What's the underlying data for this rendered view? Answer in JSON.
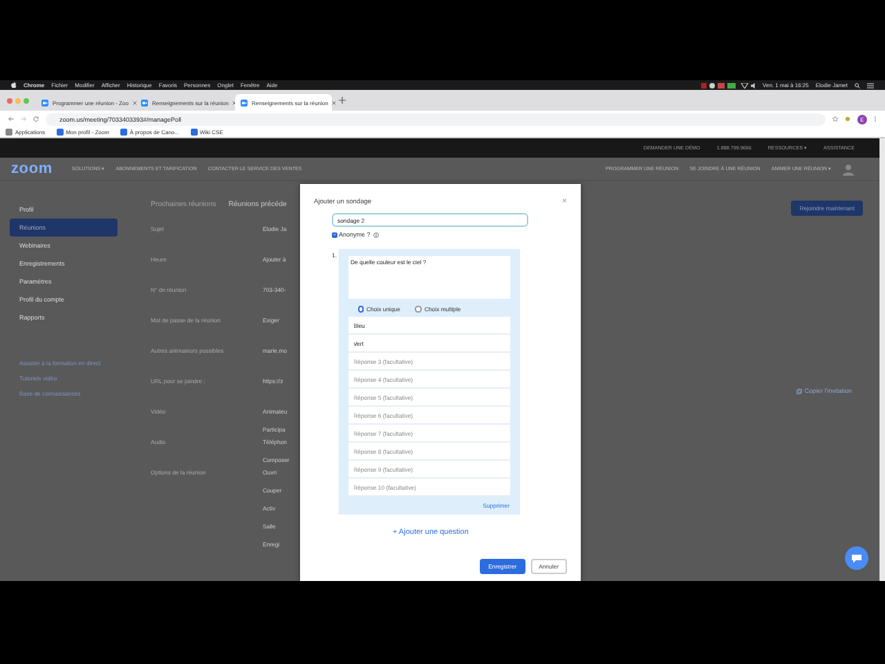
{
  "menu_bar": {
    "app": "Chrome",
    "items": [
      "Fichier",
      "Modifier",
      "Afficher",
      "Historique",
      "Favoris",
      "Personnes",
      "Onglet",
      "Fenêtre",
      "Aide"
    ],
    "clock": "Ven. 1 mai à 16:25",
    "user": "Elodie Jamet"
  },
  "browser_tabs": [
    {
      "title": "Programmer une réunion - Zoo",
      "selected": false
    },
    {
      "title": "Renseignements sur la réunion",
      "selected": false
    },
    {
      "title": "Renseignements sur la réunion",
      "selected": true
    }
  ],
  "address_bar": {
    "url": "zoom.us/meeting/7033403393#/managePoll",
    "profile_initial": "E"
  },
  "bookmarks": [
    "Applications",
    "Mon profil - Zoom",
    "À propos de Cano...",
    "Wiki CSE"
  ],
  "top_nav": [
    "DEMANDER UNE DÉMO",
    "1.888.799.9666",
    "RESSOURCES ▾",
    "ASSISTANCE"
  ],
  "main_nav": {
    "logo": "zoom",
    "left": [
      "SOLUTIONS ▾",
      "ABONNEMENTS ET TARIFICATION",
      "CONTACTER LE SERVICE DES VENTES"
    ],
    "right": [
      "PROGRAMMER UNE RÉUNION",
      "SE JOINDRE À UNE RÉUNION",
      "ANIMER UNE RÉUNION ▾"
    ]
  },
  "sidebar": {
    "items": [
      {
        "label": "Profil",
        "selected": false
      },
      {
        "label": "Réunions",
        "selected": true
      },
      {
        "label": "Webinaires",
        "selected": false
      },
      {
        "label": "Enregistrements",
        "selected": false
      },
      {
        "label": "Paramètres",
        "selected": false
      },
      {
        "label": "Profil du compte",
        "selected": false
      },
      {
        "label": "Rapports",
        "selected": false
      }
    ],
    "links": [
      "Assister à la formation en direct",
      "Tutoriels vidéo",
      "Base de connaissances"
    ]
  },
  "meeting_tabs": [
    {
      "label": "Prochaines réunions",
      "selected": false
    },
    {
      "label": "Réunions précéde",
      "selected": true
    }
  ],
  "details": [
    {
      "label": "Sujet",
      "values": [
        "Elodie Ja"
      ]
    },
    {
      "label": "Heure",
      "values": [
        "Ajouter à"
      ]
    },
    {
      "label": "N° de réunion",
      "values": [
        "703-340-"
      ]
    },
    {
      "label": "Mot de passe de la réunion",
      "values": [
        "Exiger"
      ]
    },
    {
      "label": "Autres animateurs possibles",
      "values": [
        "marie.mo"
      ]
    },
    {
      "label": "URL pour se joindre :",
      "values": [
        "https://z"
      ]
    },
    {
      "label": "Vidéo",
      "values": [
        "Animateu",
        "Participa"
      ]
    },
    {
      "label": "Audio",
      "values": [
        "Téléphon",
        "Composer"
      ]
    },
    {
      "label": "Options de la réunion",
      "values": [
        "Ouvri",
        "Couper",
        "Activ",
        "Salle",
        "Enregi"
      ]
    }
  ],
  "join_button": "Rejoindre maintenant",
  "copy_invitation": "Copier l'invitation",
  "dialog": {
    "title": "Ajouter un sondage",
    "close": "×",
    "poll_name": "sondage 2",
    "anonymous": {
      "label": "Anonyme ?",
      "checked": true
    },
    "question": {
      "number": "1.",
      "text": "De quelle couleur est le ciel ?",
      "types": [
        {
          "label": "Choix unique",
          "selected": true
        },
        {
          "label": "Choix multiple",
          "selected": false
        }
      ],
      "answers": [
        {
          "value": "Bleu"
        },
        {
          "value": "Vert"
        },
        {
          "placeholder": "Réponse 3 (facultative)"
        },
        {
          "placeholder": "Réponse 4 (facultative)"
        },
        {
          "placeholder": "Réponse 5 (facultative)"
        },
        {
          "placeholder": "Réponse 6 (facultative)"
        },
        {
          "placeholder": "Réponse 7 (facultative)"
        },
        {
          "placeholder": "Réponse 8 (facultative)"
        },
        {
          "placeholder": "Réponse 9 (facultative)"
        },
        {
          "placeholder": "Réponse 10 (facultative)"
        }
      ],
      "delete": "Supprimer"
    },
    "add_question": "+ Ajouter une question",
    "buttons": [
      {
        "label": "Enregistrer",
        "kind": "primary"
      },
      {
        "label": "Annuler",
        "kind": "secondary"
      }
    ]
  }
}
